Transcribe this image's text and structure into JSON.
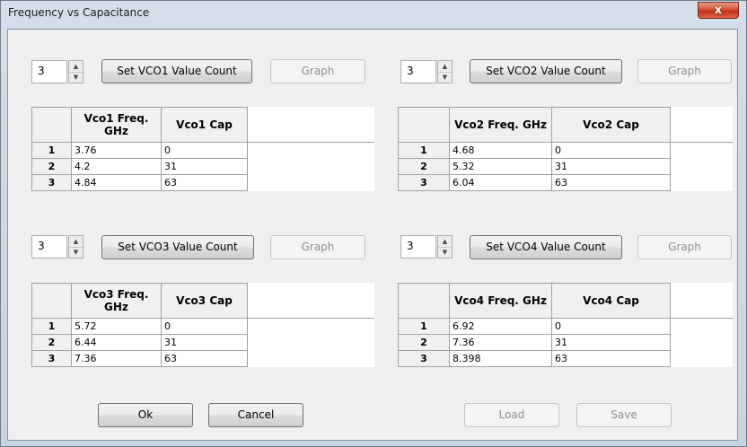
{
  "window": {
    "title": "Frequency vs Capacitance",
    "close_glyph": "x"
  },
  "vco1": {
    "count": "3",
    "set_label": "Set VCO1 Value Count",
    "graph_label": "Graph",
    "headers": [
      "",
      "Vco1 Freq. GHz",
      "Vco1 Cap"
    ],
    "rows": [
      {
        "n": "1",
        "freq": "3.76",
        "cap": "0"
      },
      {
        "n": "2",
        "freq": "4.2",
        "cap": "31"
      },
      {
        "n": "3",
        "freq": "4.84",
        "cap": "63"
      }
    ]
  },
  "vco2": {
    "count": "3",
    "set_label": "Set VCO2 Value Count",
    "graph_label": "Graph",
    "headers": [
      "",
      "Vco2 Freq. GHz",
      "Vco2 Cap"
    ],
    "rows": [
      {
        "n": "1",
        "freq": "4.68",
        "cap": "0"
      },
      {
        "n": "2",
        "freq": "5.32",
        "cap": "31"
      },
      {
        "n": "3",
        "freq": "6.04",
        "cap": "63"
      }
    ]
  },
  "vco3": {
    "count": "3",
    "set_label": "Set VCO3 Value Count",
    "graph_label": "Graph",
    "headers": [
      "",
      "Vco3 Freq. GHz",
      "Vco3 Cap"
    ],
    "rows": [
      {
        "n": "1",
        "freq": "5.72",
        "cap": "0"
      },
      {
        "n": "2",
        "freq": "6.44",
        "cap": "31"
      },
      {
        "n": "3",
        "freq": "7.36",
        "cap": "63"
      }
    ]
  },
  "vco4": {
    "count": "3",
    "set_label": "Set VCO4 Value Count",
    "graph_label": "Graph",
    "headers": [
      "",
      "Vco4 Freq. GHz",
      "Vco4 Cap"
    ],
    "rows": [
      {
        "n": "1",
        "freq": "6.92",
        "cap": "0"
      },
      {
        "n": "2",
        "freq": "7.36",
        "cap": "31"
      },
      {
        "n": "3",
        "freq": "8.398",
        "cap": "63"
      }
    ]
  },
  "footer": {
    "ok_label": "Ok",
    "cancel_label": "Cancel",
    "load_label": "Load",
    "save_label": "Save"
  },
  "icons": {
    "spin_up": "up-arrow-icon",
    "spin_down": "down-arrow-icon",
    "close": "close-icon"
  }
}
